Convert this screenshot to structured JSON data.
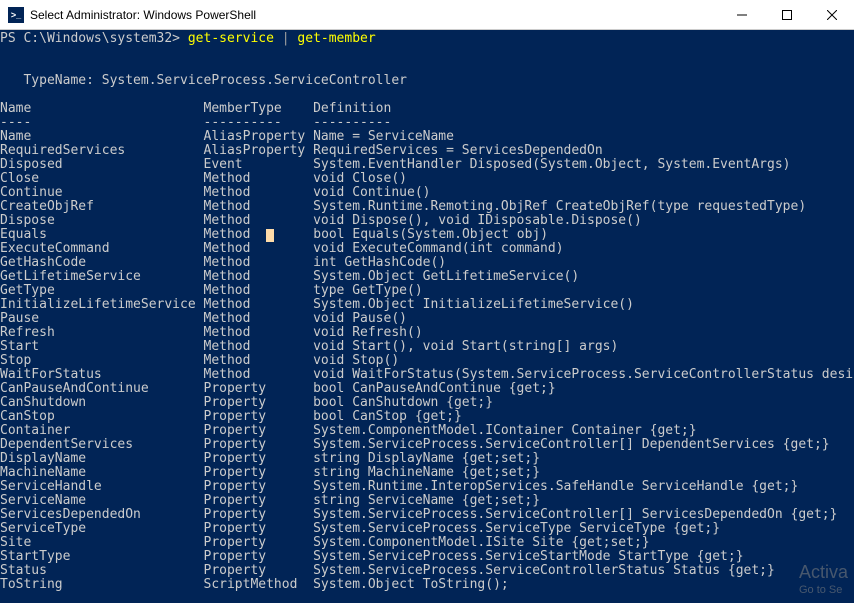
{
  "window": {
    "title": "Select Administrator: Windows PowerShell"
  },
  "prompt": "PS C:\\Windows\\system32>",
  "command_part1": "get-service",
  "command_pipe": " | ",
  "command_part2": "get-member",
  "typename_line": "   TypeName: System.ServiceProcess.ServiceController",
  "header": {
    "name": "Name",
    "membertype": "MemberType",
    "definition": "Definition"
  },
  "header_dash": {
    "name": "----",
    "membertype": "----------",
    "definition": "----------"
  },
  "rows": [
    {
      "name": "Name",
      "membertype": "AliasProperty",
      "definition": "Name = ServiceName"
    },
    {
      "name": "RequiredServices",
      "membertype": "AliasProperty",
      "definition": "RequiredServices = ServicesDependedOn"
    },
    {
      "name": "Disposed",
      "membertype": "Event",
      "definition": "System.EventHandler Disposed(System.Object, System.EventArgs)"
    },
    {
      "name": "Close",
      "membertype": "Method",
      "definition": "void Close()"
    },
    {
      "name": "Continue",
      "membertype": "Method",
      "definition": "void Continue()"
    },
    {
      "name": "CreateObjRef",
      "membertype": "Method",
      "definition": "System.Runtime.Remoting.ObjRef CreateObjRef(type requestedType)"
    },
    {
      "name": "Dispose",
      "membertype": "Method",
      "definition": "void Dispose(), void IDisposable.Dispose()"
    },
    {
      "name": "Equals",
      "membertype": "Method",
      "definition": "bool Equals(System.Object obj)",
      "cursor": true
    },
    {
      "name": "ExecuteCommand",
      "membertype": "Method",
      "definition": "void ExecuteCommand(int command)"
    },
    {
      "name": "GetHashCode",
      "membertype": "Method",
      "definition": "int GetHashCode()"
    },
    {
      "name": "GetLifetimeService",
      "membertype": "Method",
      "definition": "System.Object GetLifetimeService()"
    },
    {
      "name": "GetType",
      "membertype": "Method",
      "definition": "type GetType()"
    },
    {
      "name": "InitializeLifetimeService",
      "membertype": "Method",
      "definition": "System.Object InitializeLifetimeService()"
    },
    {
      "name": "Pause",
      "membertype": "Method",
      "definition": "void Pause()"
    },
    {
      "name": "Refresh",
      "membertype": "Method",
      "definition": "void Refresh()"
    },
    {
      "name": "Start",
      "membertype": "Method",
      "definition": "void Start(), void Start(string[] args)"
    },
    {
      "name": "Stop",
      "membertype": "Method",
      "definition": "void Stop()"
    },
    {
      "name": "WaitForStatus",
      "membertype": "Method",
      "definition": "void WaitForStatus(System.ServiceProcess.ServiceControllerStatus desiredStat..."
    },
    {
      "name": "CanPauseAndContinue",
      "membertype": "Property",
      "definition": "bool CanPauseAndContinue {get;}"
    },
    {
      "name": "CanShutdown",
      "membertype": "Property",
      "definition": "bool CanShutdown {get;}"
    },
    {
      "name": "CanStop",
      "membertype": "Property",
      "definition": "bool CanStop {get;}"
    },
    {
      "name": "Container",
      "membertype": "Property",
      "definition": "System.ComponentModel.IContainer Container {get;}"
    },
    {
      "name": "DependentServices",
      "membertype": "Property",
      "definition": "System.ServiceProcess.ServiceController[] DependentServices {get;}"
    },
    {
      "name": "DisplayName",
      "membertype": "Property",
      "definition": "string DisplayName {get;set;}"
    },
    {
      "name": "MachineName",
      "membertype": "Property",
      "definition": "string MachineName {get;set;}"
    },
    {
      "name": "ServiceHandle",
      "membertype": "Property",
      "definition": "System.Runtime.InteropServices.SafeHandle ServiceHandle {get;}"
    },
    {
      "name": "ServiceName",
      "membertype": "Property",
      "definition": "string ServiceName {get;set;}"
    },
    {
      "name": "ServicesDependedOn",
      "membertype": "Property",
      "definition": "System.ServiceProcess.ServiceController[] ServicesDependedOn {get;}"
    },
    {
      "name": "ServiceType",
      "membertype": "Property",
      "definition": "System.ServiceProcess.ServiceType ServiceType {get;}"
    },
    {
      "name": "Site",
      "membertype": "Property",
      "definition": "System.ComponentModel.ISite Site {get;set;}"
    },
    {
      "name": "StartType",
      "membertype": "Property",
      "definition": "System.ServiceProcess.ServiceStartMode StartType {get;}"
    },
    {
      "name": "Status",
      "membertype": "Property",
      "definition": "System.ServiceProcess.ServiceControllerStatus Status {get;}"
    },
    {
      "name": "ToString",
      "membertype": "ScriptMethod",
      "definition": "System.Object ToString();"
    }
  ],
  "watermark": {
    "l1": "Activa",
    "l2": "Go to Se"
  },
  "col_widths": {
    "name": 26,
    "membertype": 14
  }
}
